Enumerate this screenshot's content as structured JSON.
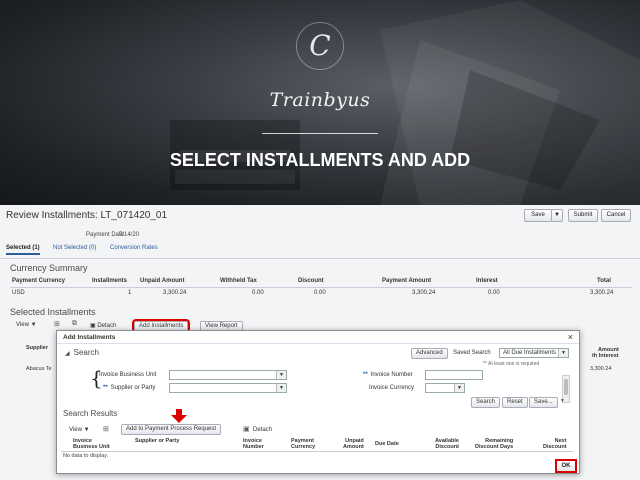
{
  "banner": {
    "logo_letter": "C",
    "brand": "Trainbyus",
    "title": "SELECT INSTALLMENTS AND ADD"
  },
  "app": {
    "title": "Review Installments: LT_071420_01",
    "toolbar": {
      "save": "Save",
      "submit": "Submit",
      "cancel": "Cancel"
    },
    "payment_date_label": "Payment Date",
    "payment_date": "7/14/20",
    "tabs": [
      "Selected (1)",
      "Not Selected (0)",
      "Conversion Rates"
    ],
    "currency_summary": {
      "heading": "Currency Summary",
      "columns": [
        "Payment Currency",
        "Installments",
        "Unpaid Amount",
        "Withheld Tax",
        "Discount",
        "Payment Amount",
        "Interest",
        "Total"
      ],
      "row": [
        "USD",
        "1",
        "3,300.24",
        "0.00",
        "0.00",
        "3,300.24",
        "0.00",
        "3,300.24"
      ]
    },
    "selected_installments": {
      "heading": "Selected Installments",
      "view": "View",
      "detach": "Detach",
      "add_installments": "Add Installments",
      "view_report": "View Report",
      "col_supplier": "Supplier",
      "col_amount": "Amount",
      "col_with_interest": "th Interest",
      "row_supplier": "Abacus Te",
      "row_amount": "3,300.24"
    }
  },
  "dialog": {
    "title": "Add Installments",
    "close": "×",
    "search_heading": "Search",
    "advanced": "Advanced",
    "saved_search_label": "Saved Search",
    "saved_search_value": "All Due Installments",
    "required_note": "** At least one is required",
    "fields": {
      "invoice_business_unit": "Invoice Business Unit",
      "supplier_or_party": "Supplier or Party",
      "invoice_number": "Invoice Number",
      "invoice_currency": "Invoice Currency",
      "req_mark": "**"
    },
    "buttons": {
      "search": "Search",
      "reset": "Reset",
      "save": "Save..."
    },
    "results_heading": "Search Results",
    "view": "View",
    "add_to_payment": "Add to Payment Process Request",
    "detach": "Detach",
    "columns": {
      "bu": [
        "Invoice",
        "Business Unit"
      ],
      "supplier": [
        "Supplier or Party"
      ],
      "invoice_number": [
        "Invoice",
        "Number"
      ],
      "payment_currency": [
        "Payment",
        "Currency"
      ],
      "unpaid_amount": [
        "Unpaid",
        "Amount"
      ],
      "due_date": [
        "Due Date"
      ],
      "available_discount": [
        "Available",
        "Discount"
      ],
      "remaining_discount_days": [
        "Remaining",
        "Discount Days"
      ],
      "next_discount": [
        "Next",
        "Discount"
      ]
    },
    "no_data": "No data to display.",
    "ok": "OK"
  },
  "colors": {
    "highlight": "#dd0000",
    "link": "#2a5d9b",
    "banner_dark": "#1f2226"
  }
}
